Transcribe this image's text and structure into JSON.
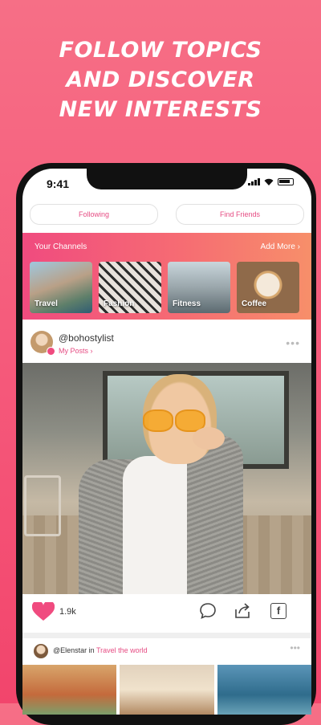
{
  "promo": {
    "line1": "FOLLOW TOPICS",
    "line2": "AND DISCOVER",
    "line3": "NEW INTERESTS"
  },
  "status": {
    "time": "9:41"
  },
  "tabs": {
    "following": "Following",
    "find_friends": "Find Friends"
  },
  "channels": {
    "title": "Your Channels",
    "add_more": "Add More ›",
    "items": [
      {
        "label": "Travel"
      },
      {
        "label": "Fashion"
      },
      {
        "label": "Fitness"
      },
      {
        "label": "Coffee"
      }
    ]
  },
  "post": {
    "username": "@bohostylist",
    "my_posts": "My Posts ›",
    "more": "•••",
    "likes": "1.9k"
  },
  "post2": {
    "user": "@Elenstar",
    "connector": " in ",
    "topic": "Travel the world",
    "more": "•••"
  },
  "colors": {
    "accent": "#e64c83",
    "background": "#f5587a",
    "heart": "#f04b7f"
  }
}
